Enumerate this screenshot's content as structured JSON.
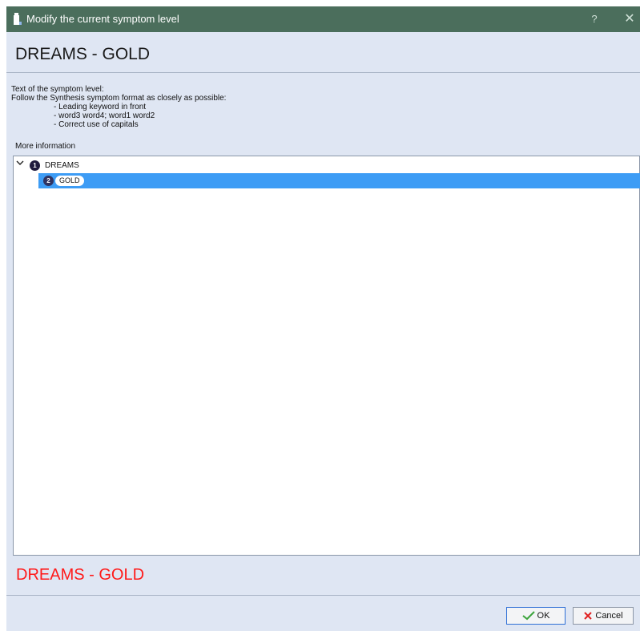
{
  "window": {
    "title": "Modify the current symptom level",
    "help_label": "?",
    "close_label": "✕",
    "app_icon": "bottle-icon"
  },
  "header": {
    "title": "DREAMS - GOLD"
  },
  "instructions": {
    "line1": "Text of the symptom level:",
    "line2": "Follow the Synthesis symptom format as closely as possible:",
    "bullets": [
      "- Leading keyword in front",
      "- word3 word4; word1 word2",
      "- Correct use of capitals"
    ],
    "more_info": "More information"
  },
  "tree": {
    "nodes": [
      {
        "level": "1",
        "label": "DREAMS",
        "expanded": true
      },
      {
        "level": "2",
        "label": "GOLD",
        "selected": true
      }
    ]
  },
  "result": {
    "text": "DREAMS - GOLD",
    "color": "#ff1a1a"
  },
  "buttons": {
    "ok": "OK",
    "cancel": "Cancel"
  },
  "colors": {
    "titlebar": "#4b6e5c",
    "selection": "#3d9cf5",
    "background": "#dfe6f3"
  }
}
